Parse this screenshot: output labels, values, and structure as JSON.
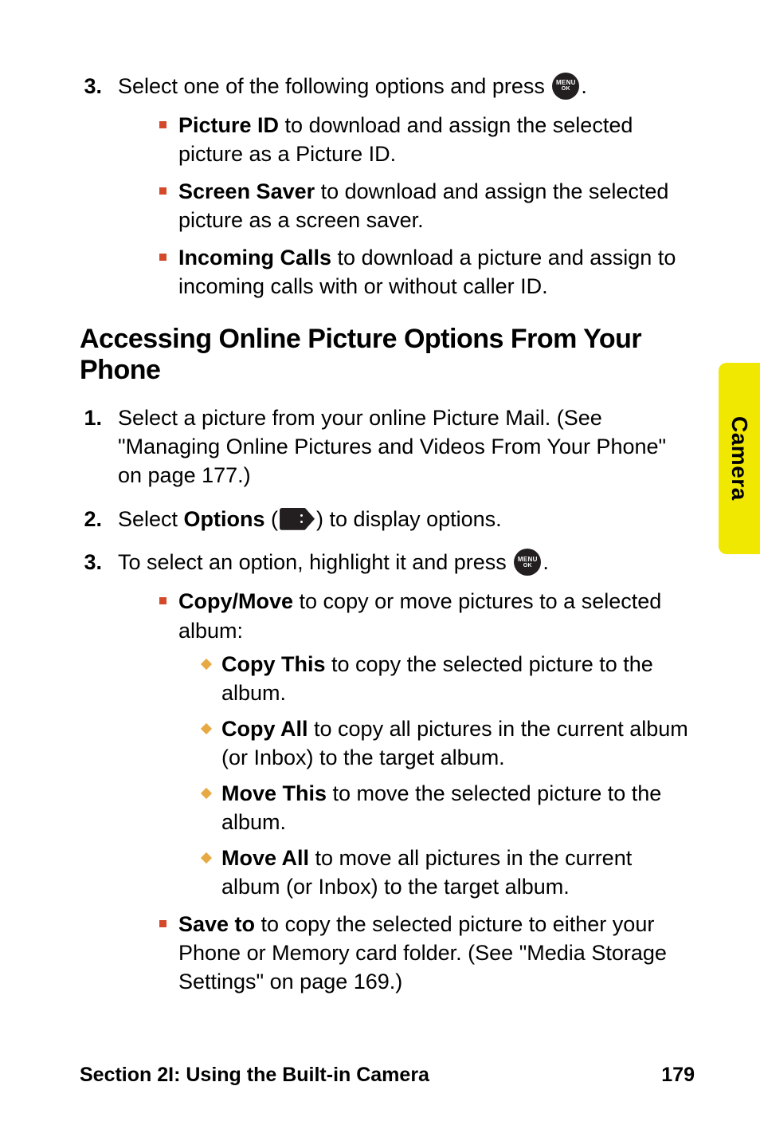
{
  "sideTab": "Camera",
  "footer": {
    "left": "Section 2I: Using the Built-in Camera",
    "right": "179"
  },
  "sectionTitle": "Accessing Online Picture Options From Your Phone",
  "topList": {
    "item3": {
      "num": "3.",
      "lead": "Select one of the following options and press ",
      "tail": ".",
      "bullets": {
        "b1_bold": "Picture ID",
        "b1_rest": " to download and assign the selected picture as a Picture ID.",
        "b2_bold": "Screen Saver",
        "b2_rest": " to download and assign the selected picture as a screen saver.",
        "b3_bold": "Incoming Calls",
        "b3_rest": " to download a picture and assign to incoming calls with or without caller ID."
      }
    }
  },
  "mainList": {
    "item1": {
      "num": "1.",
      "text": "Select a picture from your online Picture Mail. (See \"Managing Online Pictures and Videos From Your Phone\" on page 177.)"
    },
    "item2": {
      "num": "2.",
      "pre": "Select ",
      "bold": "Options",
      "mid": " (",
      "post": ") to display options."
    },
    "item3": {
      "num": "3.",
      "pre": "To select an option, highlight it and press ",
      "post": ".",
      "bullets": {
        "copyMove_bold": "Copy/Move",
        "copyMove_rest": " to copy or move pictures to a selected album:",
        "copyThis_bold": "Copy This",
        "copyThis_rest": " to copy the selected picture to the album.",
        "copyAll_bold": "Copy All",
        "copyAll_rest": " to copy all pictures in the current album (or Inbox) to the target album.",
        "moveThis_bold": "Move This",
        "moveThis_rest": " to move the selected picture to the album.",
        "moveAll_bold": "Move All",
        "moveAll_rest": " to move all pictures in the current album (or Inbox) to the target album.",
        "saveTo_bold": "Save to",
        "saveTo_rest": " to copy the selected picture to either your Phone or Memory card folder. (See \"Media Storage Settings\" on page 169.)"
      }
    }
  },
  "icons": {
    "menuLine1": "MENU",
    "menuLine2": "OK"
  }
}
